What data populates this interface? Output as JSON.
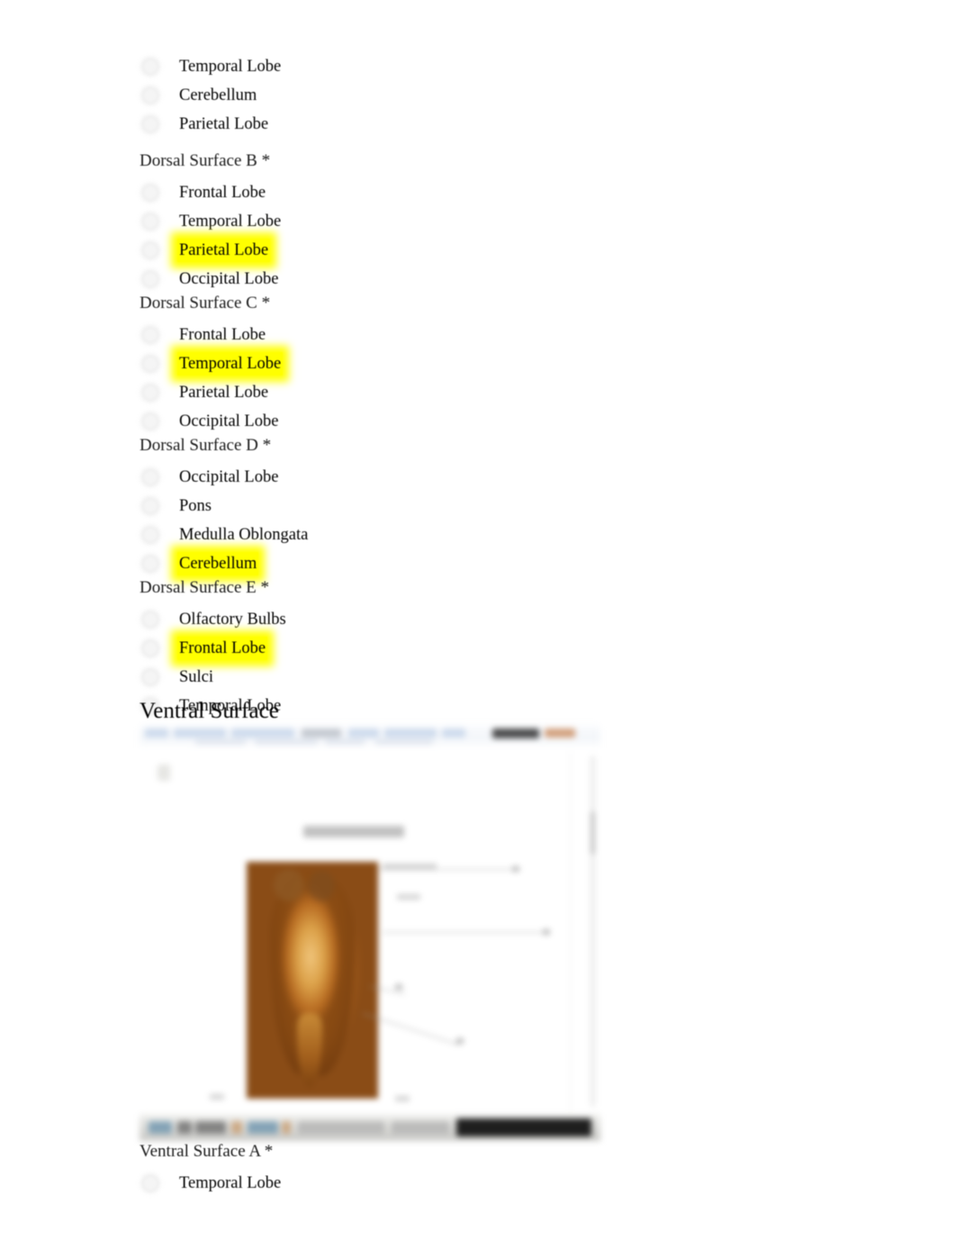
{
  "document": {
    "background_color": "#ffffff",
    "highlight_color": "#ffff00",
    "text_color": "#000000"
  },
  "partial_group_top": {
    "options": [
      {
        "label": "Temporal Lobe",
        "highlighted": false
      },
      {
        "label": "Cerebellum",
        "highlighted": false
      },
      {
        "label": "Parietal Lobe",
        "highlighted": false
      }
    ]
  },
  "groups": [
    {
      "heading": "Dorsal Surface B *",
      "options": [
        {
          "label": "Frontal Lobe",
          "highlighted": false
        },
        {
          "label": "Temporal Lobe",
          "highlighted": false
        },
        {
          "label": "Parietal Lobe",
          "highlighted": true
        },
        {
          "label": "Occipital Lobe",
          "highlighted": false
        }
      ]
    },
    {
      "heading": "Dorsal Surface C *",
      "options": [
        {
          "label": "Frontal Lobe",
          "highlighted": false
        },
        {
          "label": "Temporal Lobe",
          "highlighted": true
        },
        {
          "label": "Parietal Lobe",
          "highlighted": false
        },
        {
          "label": "Occipital Lobe",
          "highlighted": false
        }
      ]
    },
    {
      "heading": "Dorsal Surface D *",
      "options": [
        {
          "label": "Occipital Lobe",
          "highlighted": false
        },
        {
          "label": "Pons",
          "highlighted": false
        },
        {
          "label": "Medulla Oblongata",
          "highlighted": false
        },
        {
          "label": "Cerebellum",
          "highlighted": true
        }
      ]
    },
    {
      "heading": "Dorsal Surface E *",
      "options": [
        {
          "label": "Olfactory Bulbs",
          "highlighted": false
        },
        {
          "label": "Frontal Lobe",
          "highlighted": true
        },
        {
          "label": "Sulci",
          "highlighted": false
        },
        {
          "label": "Temporal Lobe",
          "highlighted": false
        }
      ]
    }
  ],
  "ventral_section": {
    "title": "Ventral Surface",
    "heading": "Ventral Surface A *",
    "options": [
      {
        "label": "Temporal Lobe",
        "highlighted": false
      }
    ]
  },
  "embedded_screenshot": {
    "description": "blurred screenshot of a document window showing a labeled brain specimen photograph",
    "figure_caption": "Ventral Surface",
    "readable": false
  },
  "icons": {
    "radio": "radio-button-unselected"
  }
}
